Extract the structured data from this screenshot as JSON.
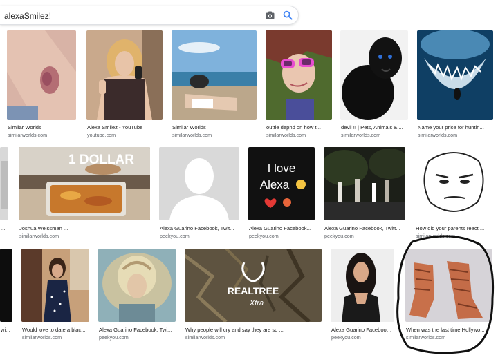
{
  "search": {
    "query": "alexaSmilez!",
    "camera_icon": "camera-icon",
    "search_icon": "magnifier-icon"
  },
  "results": {
    "row1": [
      {
        "caption": "Similar Worlds",
        "source": "similarworlds.com",
        "depicts": "bruised leg"
      },
      {
        "caption": "Alexa Smilez - YouTube",
        "source": "youtube.com",
        "depicts": "woman selfie"
      },
      {
        "caption": "Similar Worlds",
        "source": "similarworlds.com",
        "depicts": "person lying on beach"
      },
      {
        "caption": "outtie depnd on how t...",
        "source": "similarworlds.com",
        "depicts": "woman with pink sunglasses"
      },
      {
        "caption": "devil !! | Pets, Animals & ...",
        "source": "similarworlds.com",
        "depicts": "black panther"
      },
      {
        "caption": "Name your price for huntin...",
        "source": "similarworlds.com",
        "depicts": "shark and diver"
      }
    ],
    "row2": [
      {
        "caption": "...",
        "source": "",
        "depicts": "cropped image"
      },
      {
        "caption": "Joshua Weissman ...",
        "source": "similarworlds.com",
        "depicts": "lasagna",
        "overlay_text": "1 DOLLAR"
      },
      {
        "caption": "Alexa Guarino Facebook, Twit...",
        "source": "peekyou.com",
        "depicts": "default profile silhouette"
      },
      {
        "caption": "Alexa Guarino Facebook...",
        "source": "peekyou.com",
        "depicts": "text graphic",
        "overlay_text_line1": "I love",
        "overlay_text_line2": "Alexa"
      },
      {
        "caption": "Alexa Guarino Facebook, Twitt...",
        "source": "peekyou.com",
        "depicts": "night party"
      },
      {
        "caption": "How did your parents react ...",
        "source": "similarworlds.com",
        "depicts": "meme face"
      }
    ],
    "row3": [
      {
        "caption": "wi...",
        "source": "",
        "depicts": "cropped image"
      },
      {
        "caption": "Would love to date a blac...",
        "source": "similarworlds.com",
        "depicts": "woman in dark dress"
      },
      {
        "caption": "Alexa Guarino Facebook, Twi...",
        "source": "peekyou.com",
        "depicts": "woman portrait"
      },
      {
        "caption": "Why people will cry and say they are so ...",
        "source": "similarworlds.com",
        "depicts": "realtree logo",
        "overlay_text_line1": "REALTREE",
        "overlay_text_line2": "Xtra"
      },
      {
        "caption": "Alexa Guarino Facebook, ...",
        "source": "peekyou.com",
        "depicts": "woman dark hair"
      },
      {
        "caption": "When was the last time Hollywo...",
        "source": "similarworlds.com",
        "depicts": "hairy feet"
      }
    ]
  },
  "colors": {
    "accent_blue": "#4285f4",
    "text": "#222222",
    "muted": "#5f6368",
    "circle": "#111111"
  }
}
